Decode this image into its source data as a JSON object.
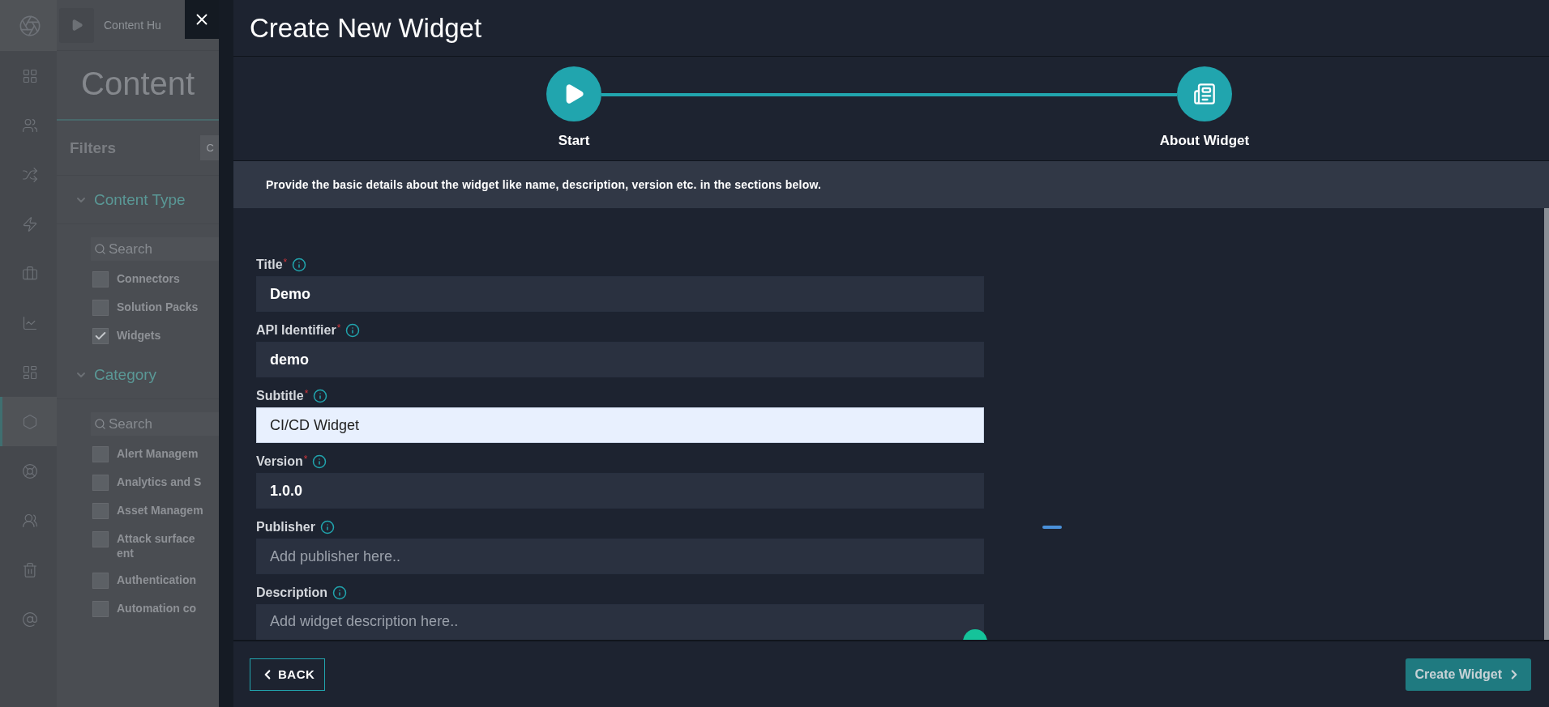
{
  "background_app": {
    "rail": [
      {
        "selected": false
      },
      {
        "selected": false
      },
      {
        "selected": false
      },
      {
        "selected": false
      },
      {
        "selected": false
      },
      {
        "selected": false
      },
      {
        "selected": false
      },
      {
        "selected": false
      },
      {
        "selected": true
      },
      {
        "selected": false
      },
      {
        "selected": false
      },
      {
        "selected": false
      },
      {
        "selected": false
      }
    ],
    "breadcrumb": "Content Hu",
    "page_title": "Content",
    "filters_label": "Filters",
    "clear_button": "C",
    "sections": [
      {
        "title": "Content Type",
        "expanded": true,
        "search_placeholder": "Search",
        "options": [
          {
            "label_lines": [
              "Connectors"
            ],
            "checked": false
          },
          {
            "label_lines": [
              "Solution Packs"
            ],
            "checked": false
          },
          {
            "label_lines": [
              "Widgets"
            ],
            "checked": true
          }
        ]
      },
      {
        "title": "Category",
        "expanded": true,
        "search_placeholder": "Search",
        "options": [
          {
            "label_lines": [
              "Alert Managem"
            ],
            "checked": false
          },
          {
            "label_lines": [
              "Analytics and S"
            ],
            "checked": false
          },
          {
            "label_lines": [
              "Asset Managem"
            ],
            "checked": false
          },
          {
            "label_lines": [
              "Attack surface",
              "ent"
            ],
            "checked": false
          },
          {
            "label_lines": [
              "Authentication"
            ],
            "checked": false
          },
          {
            "label_lines": [
              "Automation co"
            ],
            "checked": false
          }
        ]
      }
    ]
  },
  "modal": {
    "title": "Create New Widget",
    "steps": [
      {
        "kind": "start",
        "label": "Start",
        "done": true
      },
      {
        "kind": "about",
        "label": "About Widget",
        "done": true
      }
    ],
    "info": "Provide the basic details about the widget like name, description, version etc. in the sections below.",
    "fields": [
      {
        "kind": "input",
        "label": "Title",
        "required_mark": "*",
        "value": "Demo",
        "focused": false
      },
      {
        "kind": "input",
        "label": "API Identifier",
        "required_mark": "*",
        "value": "demo",
        "focused": false
      },
      {
        "kind": "input",
        "label": "Subtitle",
        "required_mark": "*",
        "value": "CI/CD Widget",
        "focused": true
      },
      {
        "kind": "input",
        "label": "Version",
        "required_mark": "*",
        "value": "1.0.0",
        "focused": false
      },
      {
        "kind": "input",
        "label": "Publisher",
        "placeholder": "Add publisher here..",
        "focused": false
      },
      {
        "kind": "textarea",
        "label": "Description",
        "placeholder": "Add widget description here..",
        "focused": false
      }
    ],
    "back_button": "BACK",
    "create_button": "Create Widget"
  }
}
